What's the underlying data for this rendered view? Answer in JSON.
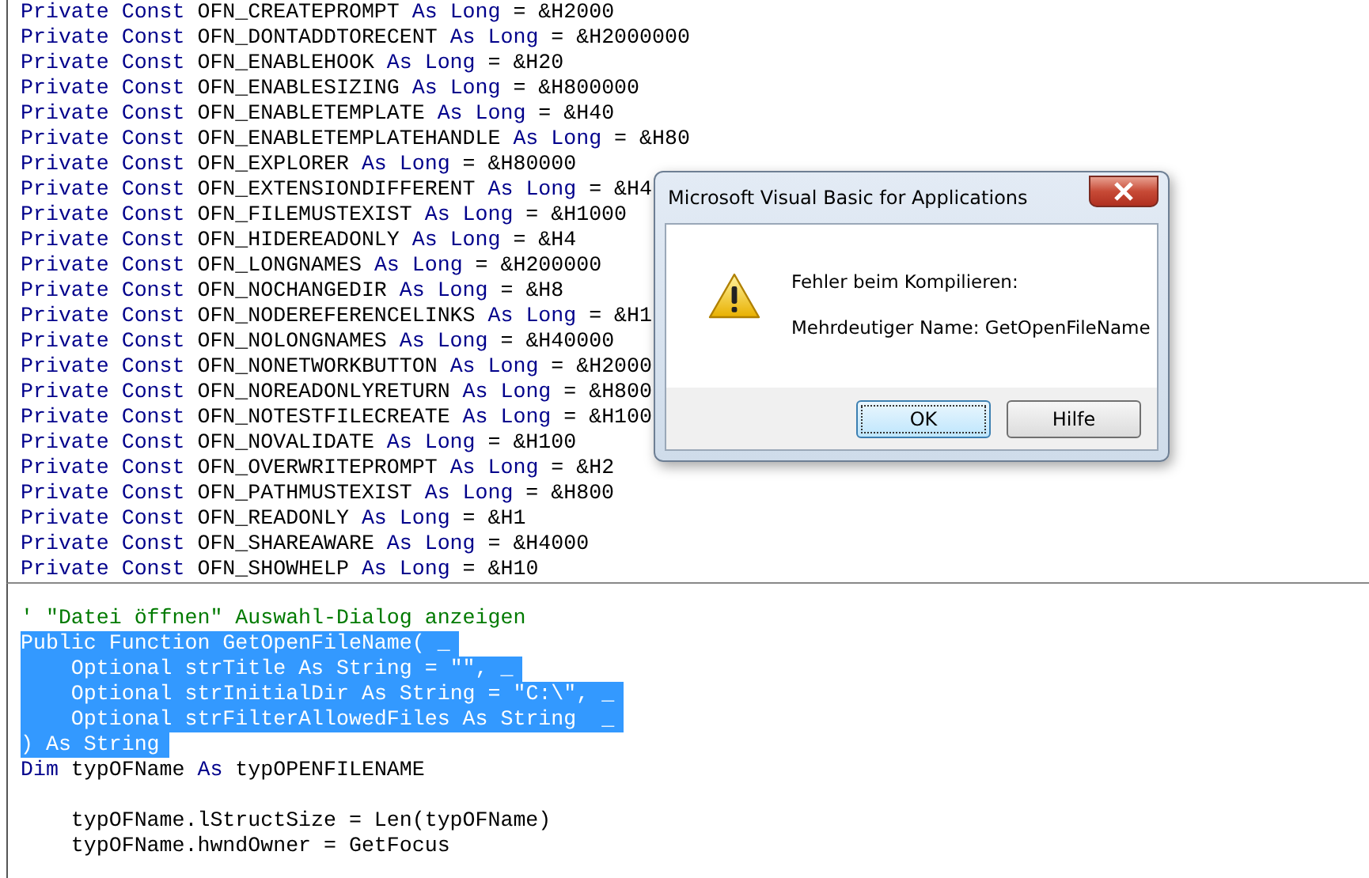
{
  "code_upper": [
    {
      "tokens": [
        {
          "kind": "keyword",
          "text": "Private Const"
        },
        {
          "kind": "plain",
          "text": " OFN_CREATEPROMPT "
        },
        {
          "kind": "keyword",
          "text": "As Long"
        },
        {
          "kind": "plain",
          "text": " = &H2000"
        }
      ]
    },
    {
      "tokens": [
        {
          "kind": "keyword",
          "text": "Private Const"
        },
        {
          "kind": "plain",
          "text": " OFN_DONTADDTORECENT "
        },
        {
          "kind": "keyword",
          "text": "As Long"
        },
        {
          "kind": "plain",
          "text": " = &H2000000"
        }
      ]
    },
    {
      "tokens": [
        {
          "kind": "keyword",
          "text": "Private Const"
        },
        {
          "kind": "plain",
          "text": " OFN_ENABLEHOOK "
        },
        {
          "kind": "keyword",
          "text": "As Long"
        },
        {
          "kind": "plain",
          "text": " = &H20"
        }
      ]
    },
    {
      "tokens": [
        {
          "kind": "keyword",
          "text": "Private Const"
        },
        {
          "kind": "plain",
          "text": " OFN_ENABLESIZING "
        },
        {
          "kind": "keyword",
          "text": "As Long"
        },
        {
          "kind": "plain",
          "text": " = &H800000"
        }
      ]
    },
    {
      "tokens": [
        {
          "kind": "keyword",
          "text": "Private Const"
        },
        {
          "kind": "plain",
          "text": " OFN_ENABLETEMPLATE "
        },
        {
          "kind": "keyword",
          "text": "As Long"
        },
        {
          "kind": "plain",
          "text": " = &H40"
        }
      ]
    },
    {
      "tokens": [
        {
          "kind": "keyword",
          "text": "Private Const"
        },
        {
          "kind": "plain",
          "text": " OFN_ENABLETEMPLATEHANDLE "
        },
        {
          "kind": "keyword",
          "text": "As Long"
        },
        {
          "kind": "plain",
          "text": " = &H80"
        }
      ]
    },
    {
      "tokens": [
        {
          "kind": "keyword",
          "text": "Private Const"
        },
        {
          "kind": "plain",
          "text": " OFN_EXPLORER "
        },
        {
          "kind": "keyword",
          "text": "As Long"
        },
        {
          "kind": "plain",
          "text": " = &H80000"
        }
      ]
    },
    {
      "tokens": [
        {
          "kind": "keyword",
          "text": "Private Const"
        },
        {
          "kind": "plain",
          "text": " OFN_EXTENSIONDIFFERENT "
        },
        {
          "kind": "keyword",
          "text": "As Long"
        },
        {
          "kind": "plain",
          "text": " = &H4"
        }
      ]
    },
    {
      "tokens": [
        {
          "kind": "keyword",
          "text": "Private Const"
        },
        {
          "kind": "plain",
          "text": " OFN_FILEMUSTEXIST "
        },
        {
          "kind": "keyword",
          "text": "As Long"
        },
        {
          "kind": "plain",
          "text": " = &H1000"
        }
      ]
    },
    {
      "tokens": [
        {
          "kind": "keyword",
          "text": "Private Const"
        },
        {
          "kind": "plain",
          "text": " OFN_HIDEREADONLY "
        },
        {
          "kind": "keyword",
          "text": "As Long"
        },
        {
          "kind": "plain",
          "text": " = &H4"
        }
      ]
    },
    {
      "tokens": [
        {
          "kind": "keyword",
          "text": "Private Const"
        },
        {
          "kind": "plain",
          "text": " OFN_LONGNAMES "
        },
        {
          "kind": "keyword",
          "text": "As Long"
        },
        {
          "kind": "plain",
          "text": " = &H200000"
        }
      ]
    },
    {
      "tokens": [
        {
          "kind": "keyword",
          "text": "Private Const"
        },
        {
          "kind": "plain",
          "text": " OFN_NOCHANGEDIR "
        },
        {
          "kind": "keyword",
          "text": "As Long"
        },
        {
          "kind": "plain",
          "text": " = &H8"
        }
      ]
    },
    {
      "tokens": [
        {
          "kind": "keyword",
          "text": "Private Const"
        },
        {
          "kind": "plain",
          "text": " OFN_NODEREFERENCELINKS "
        },
        {
          "kind": "keyword",
          "text": "As Long"
        },
        {
          "kind": "plain",
          "text": " = &H1"
        }
      ]
    },
    {
      "tokens": [
        {
          "kind": "keyword",
          "text": "Private Const"
        },
        {
          "kind": "plain",
          "text": " OFN_NOLONGNAMES "
        },
        {
          "kind": "keyword",
          "text": "As Long"
        },
        {
          "kind": "plain",
          "text": " = &H40000"
        }
      ]
    },
    {
      "tokens": [
        {
          "kind": "keyword",
          "text": "Private Const"
        },
        {
          "kind": "plain",
          "text": " OFN_NONETWORKBUTTON "
        },
        {
          "kind": "keyword",
          "text": "As Long"
        },
        {
          "kind": "plain",
          "text": " = &H2000"
        }
      ]
    },
    {
      "tokens": [
        {
          "kind": "keyword",
          "text": "Private Const"
        },
        {
          "kind": "plain",
          "text": " OFN_NOREADONLYRETURN "
        },
        {
          "kind": "keyword",
          "text": "As Long"
        },
        {
          "kind": "plain",
          "text": " = &H800"
        }
      ]
    },
    {
      "tokens": [
        {
          "kind": "keyword",
          "text": "Private Const"
        },
        {
          "kind": "plain",
          "text": " OFN_NOTESTFILECREATE "
        },
        {
          "kind": "keyword",
          "text": "As Long"
        },
        {
          "kind": "plain",
          "text": " = &H100"
        }
      ]
    },
    {
      "tokens": [
        {
          "kind": "keyword",
          "text": "Private Const"
        },
        {
          "kind": "plain",
          "text": " OFN_NOVALIDATE "
        },
        {
          "kind": "keyword",
          "text": "As Long"
        },
        {
          "kind": "plain",
          "text": " = &H100"
        }
      ]
    },
    {
      "tokens": [
        {
          "kind": "keyword",
          "text": "Private Const"
        },
        {
          "kind": "plain",
          "text": " OFN_OVERWRITEPROMPT "
        },
        {
          "kind": "keyword",
          "text": "As Long"
        },
        {
          "kind": "plain",
          "text": " = &H2"
        }
      ]
    },
    {
      "tokens": [
        {
          "kind": "keyword",
          "text": "Private Const"
        },
        {
          "kind": "plain",
          "text": " OFN_PATHMUSTEXIST "
        },
        {
          "kind": "keyword",
          "text": "As Long"
        },
        {
          "kind": "plain",
          "text": " = &H800"
        }
      ]
    },
    {
      "tokens": [
        {
          "kind": "keyword",
          "text": "Private Const"
        },
        {
          "kind": "plain",
          "text": " OFN_READONLY "
        },
        {
          "kind": "keyword",
          "text": "As Long"
        },
        {
          "kind": "plain",
          "text": " = &H1"
        }
      ]
    },
    {
      "tokens": [
        {
          "kind": "keyword",
          "text": "Private Const"
        },
        {
          "kind": "plain",
          "text": " OFN_SHAREAWARE "
        },
        {
          "kind": "keyword",
          "text": "As Long"
        },
        {
          "kind": "plain",
          "text": " = &H4000"
        }
      ]
    },
    {
      "tokens": [
        {
          "kind": "keyword",
          "text": "Private Const"
        },
        {
          "kind": "plain",
          "text": " OFN_SHOWHELP "
        },
        {
          "kind": "keyword",
          "text": "As Long"
        },
        {
          "kind": "plain",
          "text": " = &H10"
        }
      ]
    }
  ],
  "code_lower": [
    {
      "selected": false,
      "tokens": [
        {
          "kind": "comment",
          "text": "' \"Datei öffnen\" Auswahl-Dialog anzeigen"
        }
      ]
    },
    {
      "selected": true,
      "tokens": [
        {
          "kind": "keyword",
          "text": "Public Function"
        },
        {
          "kind": "plain",
          "text": " GetOpenFileName( _"
        }
      ]
    },
    {
      "selected": true,
      "tokens": [
        {
          "kind": "keyword",
          "text": "    Optional"
        },
        {
          "kind": "plain",
          "text": " strTitle "
        },
        {
          "kind": "keyword",
          "text": "As String"
        },
        {
          "kind": "plain",
          "text": " = \"\", _"
        }
      ]
    },
    {
      "selected": true,
      "tokens": [
        {
          "kind": "keyword",
          "text": "    Optional"
        },
        {
          "kind": "plain",
          "text": " strInitialDir "
        },
        {
          "kind": "keyword",
          "text": "As String"
        },
        {
          "kind": "plain",
          "text": " = \"C:\\\", _"
        }
      ]
    },
    {
      "selected": true,
      "tokens": [
        {
          "kind": "keyword",
          "text": "    Optional"
        },
        {
          "kind": "plain",
          "text": " strFilterAllowedFiles "
        },
        {
          "kind": "keyword",
          "text": "As String"
        },
        {
          "kind": "plain",
          "text": "  _"
        }
      ]
    },
    {
      "selected": true,
      "tokens": [
        {
          "kind": "plain",
          "text": ") "
        },
        {
          "kind": "keyword",
          "text": "As String"
        }
      ]
    },
    {
      "selected": false,
      "tokens": [
        {
          "kind": "keyword",
          "text": "Dim"
        },
        {
          "kind": "plain",
          "text": " typOFName "
        },
        {
          "kind": "keyword",
          "text": "As"
        },
        {
          "kind": "plain",
          "text": " typOPENFILENAME"
        }
      ]
    },
    {
      "selected": false,
      "gap_above": true,
      "tokens": [
        {
          "kind": "plain",
          "text": "    typOFName.lStructSize = Len(typOFName)"
        }
      ]
    },
    {
      "selected": false,
      "tokens": [
        {
          "kind": "plain",
          "text": "    typOFName.hwndOwner = GetFocus"
        }
      ]
    }
  ],
  "dialog": {
    "title": "Microsoft Visual Basic for Applications",
    "messages": [
      "Fehler beim Kompilieren:",
      "Mehrdeutiger Name: GetOpenFileName"
    ],
    "buttons": [
      {
        "label": "OK",
        "focused": true
      },
      {
        "label": "Hilfe",
        "focused": false
      }
    ]
  }
}
